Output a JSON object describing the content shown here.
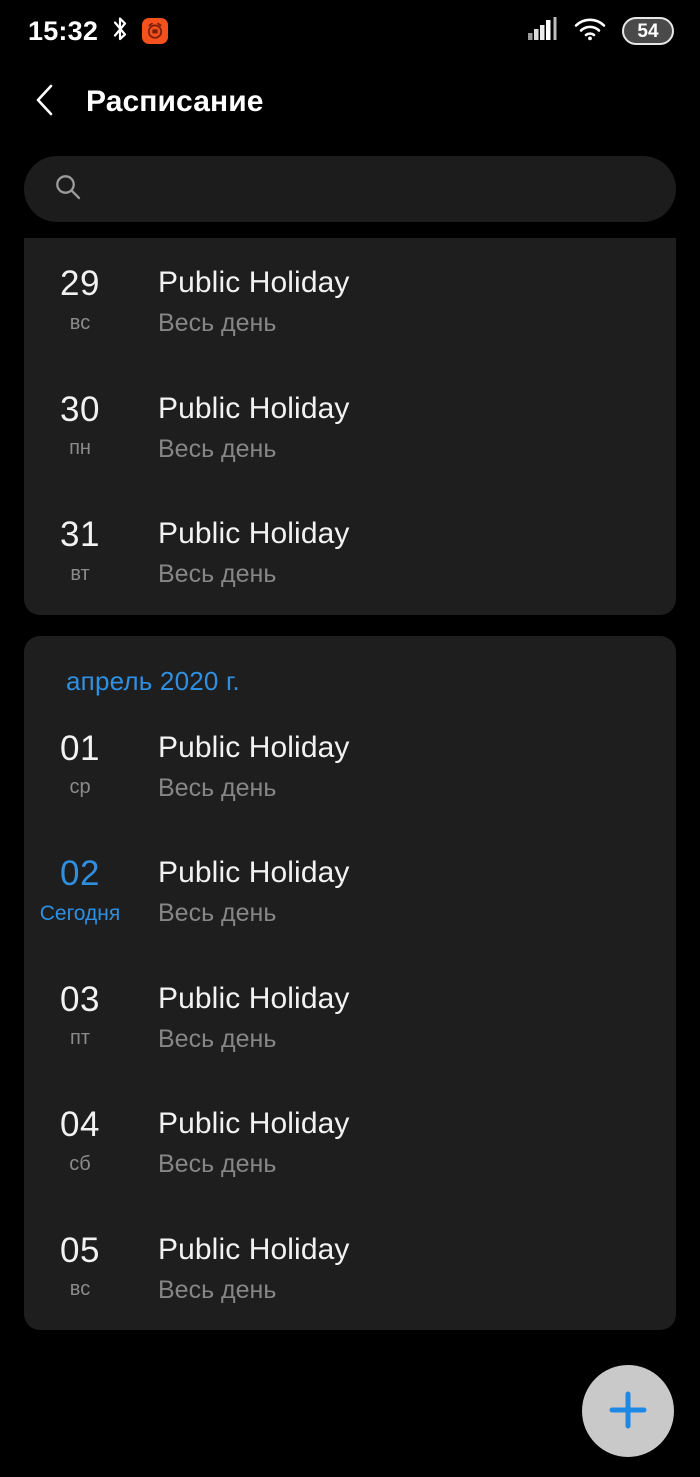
{
  "status_bar": {
    "time": "15:32",
    "bluetooth_icon": "bluetooth-icon",
    "notification_app_icon": "alarm-app-icon",
    "signal_icon": "cellular-signal-icon",
    "wifi_icon": "wifi-icon",
    "battery_level": "54"
  },
  "app_bar": {
    "back_icon": "chevron-left-icon",
    "title": "Расписание"
  },
  "search": {
    "icon": "search-icon",
    "value": "",
    "placeholder": ""
  },
  "colors": {
    "background": "#000000",
    "card": "#1e1e1e",
    "search_field": "#1c1c1c",
    "accent_blue": "#2f8fe0",
    "primary_text": "#f2f2f2",
    "secondary_text": "#868686",
    "fab_background": "#c9c9c9",
    "notification_orange": "#f4511e"
  },
  "cards": [
    {
      "month_label": null,
      "clipped_top": true,
      "events": [
        {
          "day": "29",
          "dow": "вс",
          "title": "Public Holiday",
          "time": "Весь день",
          "is_today": false
        },
        {
          "day": "30",
          "dow": "пн",
          "title": "Public Holiday",
          "time": "Весь день",
          "is_today": false
        },
        {
          "day": "31",
          "dow": "вт",
          "title": "Public Holiday",
          "time": "Весь день",
          "is_today": false
        }
      ]
    },
    {
      "month_label": "апрель 2020 г.",
      "clipped_top": false,
      "events": [
        {
          "day": "01",
          "dow": "ср",
          "title": "Public Holiday",
          "time": "Весь день",
          "is_today": false
        },
        {
          "day": "02",
          "dow": "Сегодня",
          "title": "Public Holiday",
          "time": "Весь день",
          "is_today": true
        },
        {
          "day": "03",
          "dow": "пт",
          "title": "Public Holiday",
          "time": "Весь день",
          "is_today": false
        },
        {
          "day": "04",
          "dow": "сб",
          "title": "Public Holiday",
          "time": "Весь день",
          "is_today": false
        },
        {
          "day": "05",
          "dow": "вс",
          "title": "Public Holiday",
          "time": "Весь день",
          "is_today": false
        }
      ]
    }
  ],
  "fab": {
    "icon": "plus-icon",
    "label": "Добавить"
  }
}
